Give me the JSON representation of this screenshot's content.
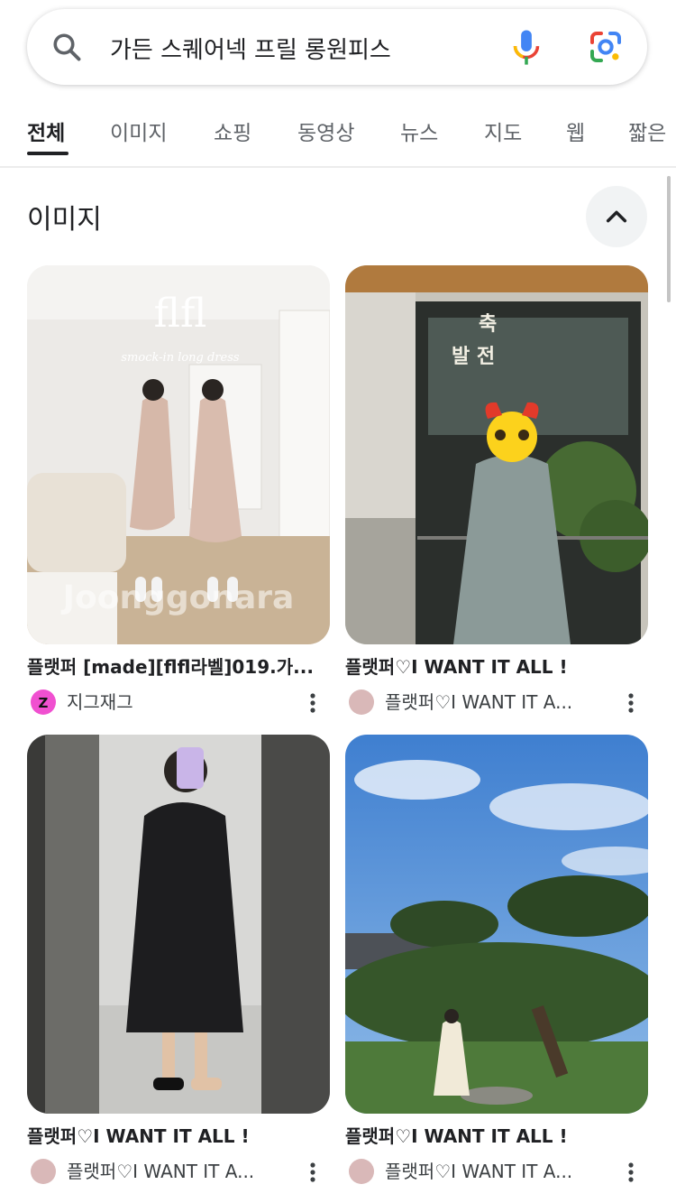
{
  "search": {
    "query": "가든 스퀘어넥 프릴 롱원피스"
  },
  "tabs": [
    {
      "label": "전체"
    },
    {
      "label": "이미지"
    },
    {
      "label": "쇼핑"
    },
    {
      "label": "동영상"
    },
    {
      "label": "뉴스"
    },
    {
      "label": "지도"
    },
    {
      "label": "웹"
    },
    {
      "label": "짧은"
    }
  ],
  "section": {
    "title": "이미지"
  },
  "results": [
    {
      "title": "플랫퍼 [made][flfl라벨]019.가...",
      "source": "지그재그",
      "avatar_letter": "Z",
      "image_text": "flfl",
      "image_subtext": "smock-in long dress"
    },
    {
      "title": "플랫퍼♡I WANT IT ALL !",
      "source": "플랫퍼♡I WANT IT A...",
      "image_text_1": "축",
      "image_text_2": "발 전"
    },
    {
      "title": "플랫퍼♡I WANT IT ALL !",
      "source": "플랫퍼♡I WANT IT A..."
    },
    {
      "title": "플랫퍼♡I WANT IT ALL !",
      "source": "플랫퍼♡I WANT IT A..."
    }
  ],
  "watermark": "Joonggonara",
  "colors": {
    "zigzag_avatar": "#f050d0",
    "flatpur_avatar": "#d9b8b8",
    "mic_blue": "#4285f4",
    "mic_red": "#ea4335",
    "mic_yellow": "#fbbc04",
    "mic_green": "#34a853"
  }
}
